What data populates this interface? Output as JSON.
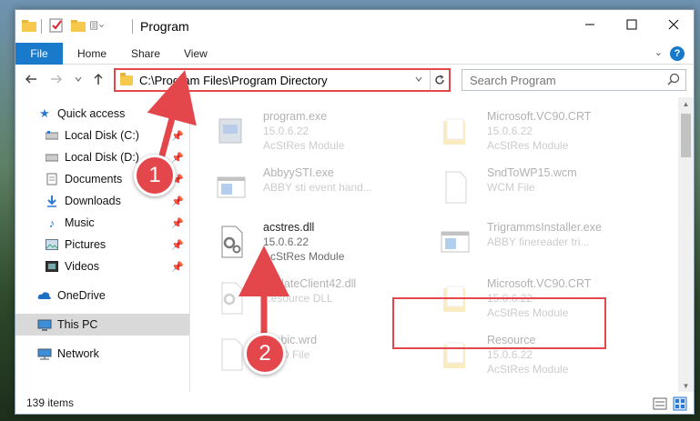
{
  "window": {
    "title": "Program"
  },
  "ribbon": {
    "file": "File",
    "home": "Home",
    "share": "Share",
    "view": "View",
    "help": "?"
  },
  "address": {
    "path": "C:\\Program Files\\Program Directory"
  },
  "search": {
    "placeholder": "Search Program"
  },
  "sidebar": {
    "items": [
      {
        "label": "Quick access",
        "icon": "star-icon"
      },
      {
        "label": "Local Disk (C:)",
        "icon": "drive-icon"
      },
      {
        "label": "Local Disk (D:)",
        "icon": "drive-icon"
      },
      {
        "label": "Documents",
        "icon": "documents-icon"
      },
      {
        "label": "Downloads",
        "icon": "download-icon"
      },
      {
        "label": "Music",
        "icon": "music-icon"
      },
      {
        "label": "Pictures",
        "icon": "pictures-icon"
      },
      {
        "label": "Videos",
        "icon": "videos-icon"
      },
      {
        "label": "OneDrive",
        "icon": "cloud-icon"
      },
      {
        "label": "This PC",
        "icon": "computer-icon"
      },
      {
        "label": "Network",
        "icon": "network-icon"
      }
    ]
  },
  "files": [
    {
      "name": "program.exe",
      "line1": "15.0.6.22",
      "line2": "AcStRes Module",
      "icon": "exe-icon"
    },
    {
      "name": "Microsoft.VC90.CRT",
      "line1": "15.0.6.22",
      "line2": "AcStRes Module",
      "icon": "folder-icon"
    },
    {
      "name": "AbbyySTI.exe",
      "line1": "ABBY sti event hand...",
      "line2": "",
      "icon": "exe-window-icon"
    },
    {
      "name": "SndToWP15.wcm",
      "line1": "WCM File",
      "line2": "",
      "icon": "blank-file-icon"
    },
    {
      "name": "acstres.dll",
      "line1": "15.0.6.22",
      "line2": "AcStRes Module",
      "icon": "dll-gear-icon"
    },
    {
      "name": "TrigrammsInstaller.exe",
      "line1": "ABBY finereader tri...",
      "line2": "",
      "icon": "exe-window-icon"
    },
    {
      "name": "UpdateClient42.dll",
      "line1": "Resource DLL",
      "line2": "",
      "icon": "dll-gear-icon"
    },
    {
      "name": "Microsoft.VC90.CRT",
      "line1": "15.0.6.22",
      "line2": "AcStRes Module",
      "icon": "folder-icon"
    },
    {
      "name": "Arabic.wrd",
      "line1": "WRD File",
      "line2": "",
      "icon": "blank-file-icon"
    },
    {
      "name": "Resource",
      "line1": "15.0.6.22",
      "line2": "AcStRes Module",
      "icon": "folder-icon"
    }
  ],
  "status": {
    "count": "139 items"
  },
  "annotations": {
    "step1": "1",
    "step2": "2",
    "color": "#e4474b"
  }
}
